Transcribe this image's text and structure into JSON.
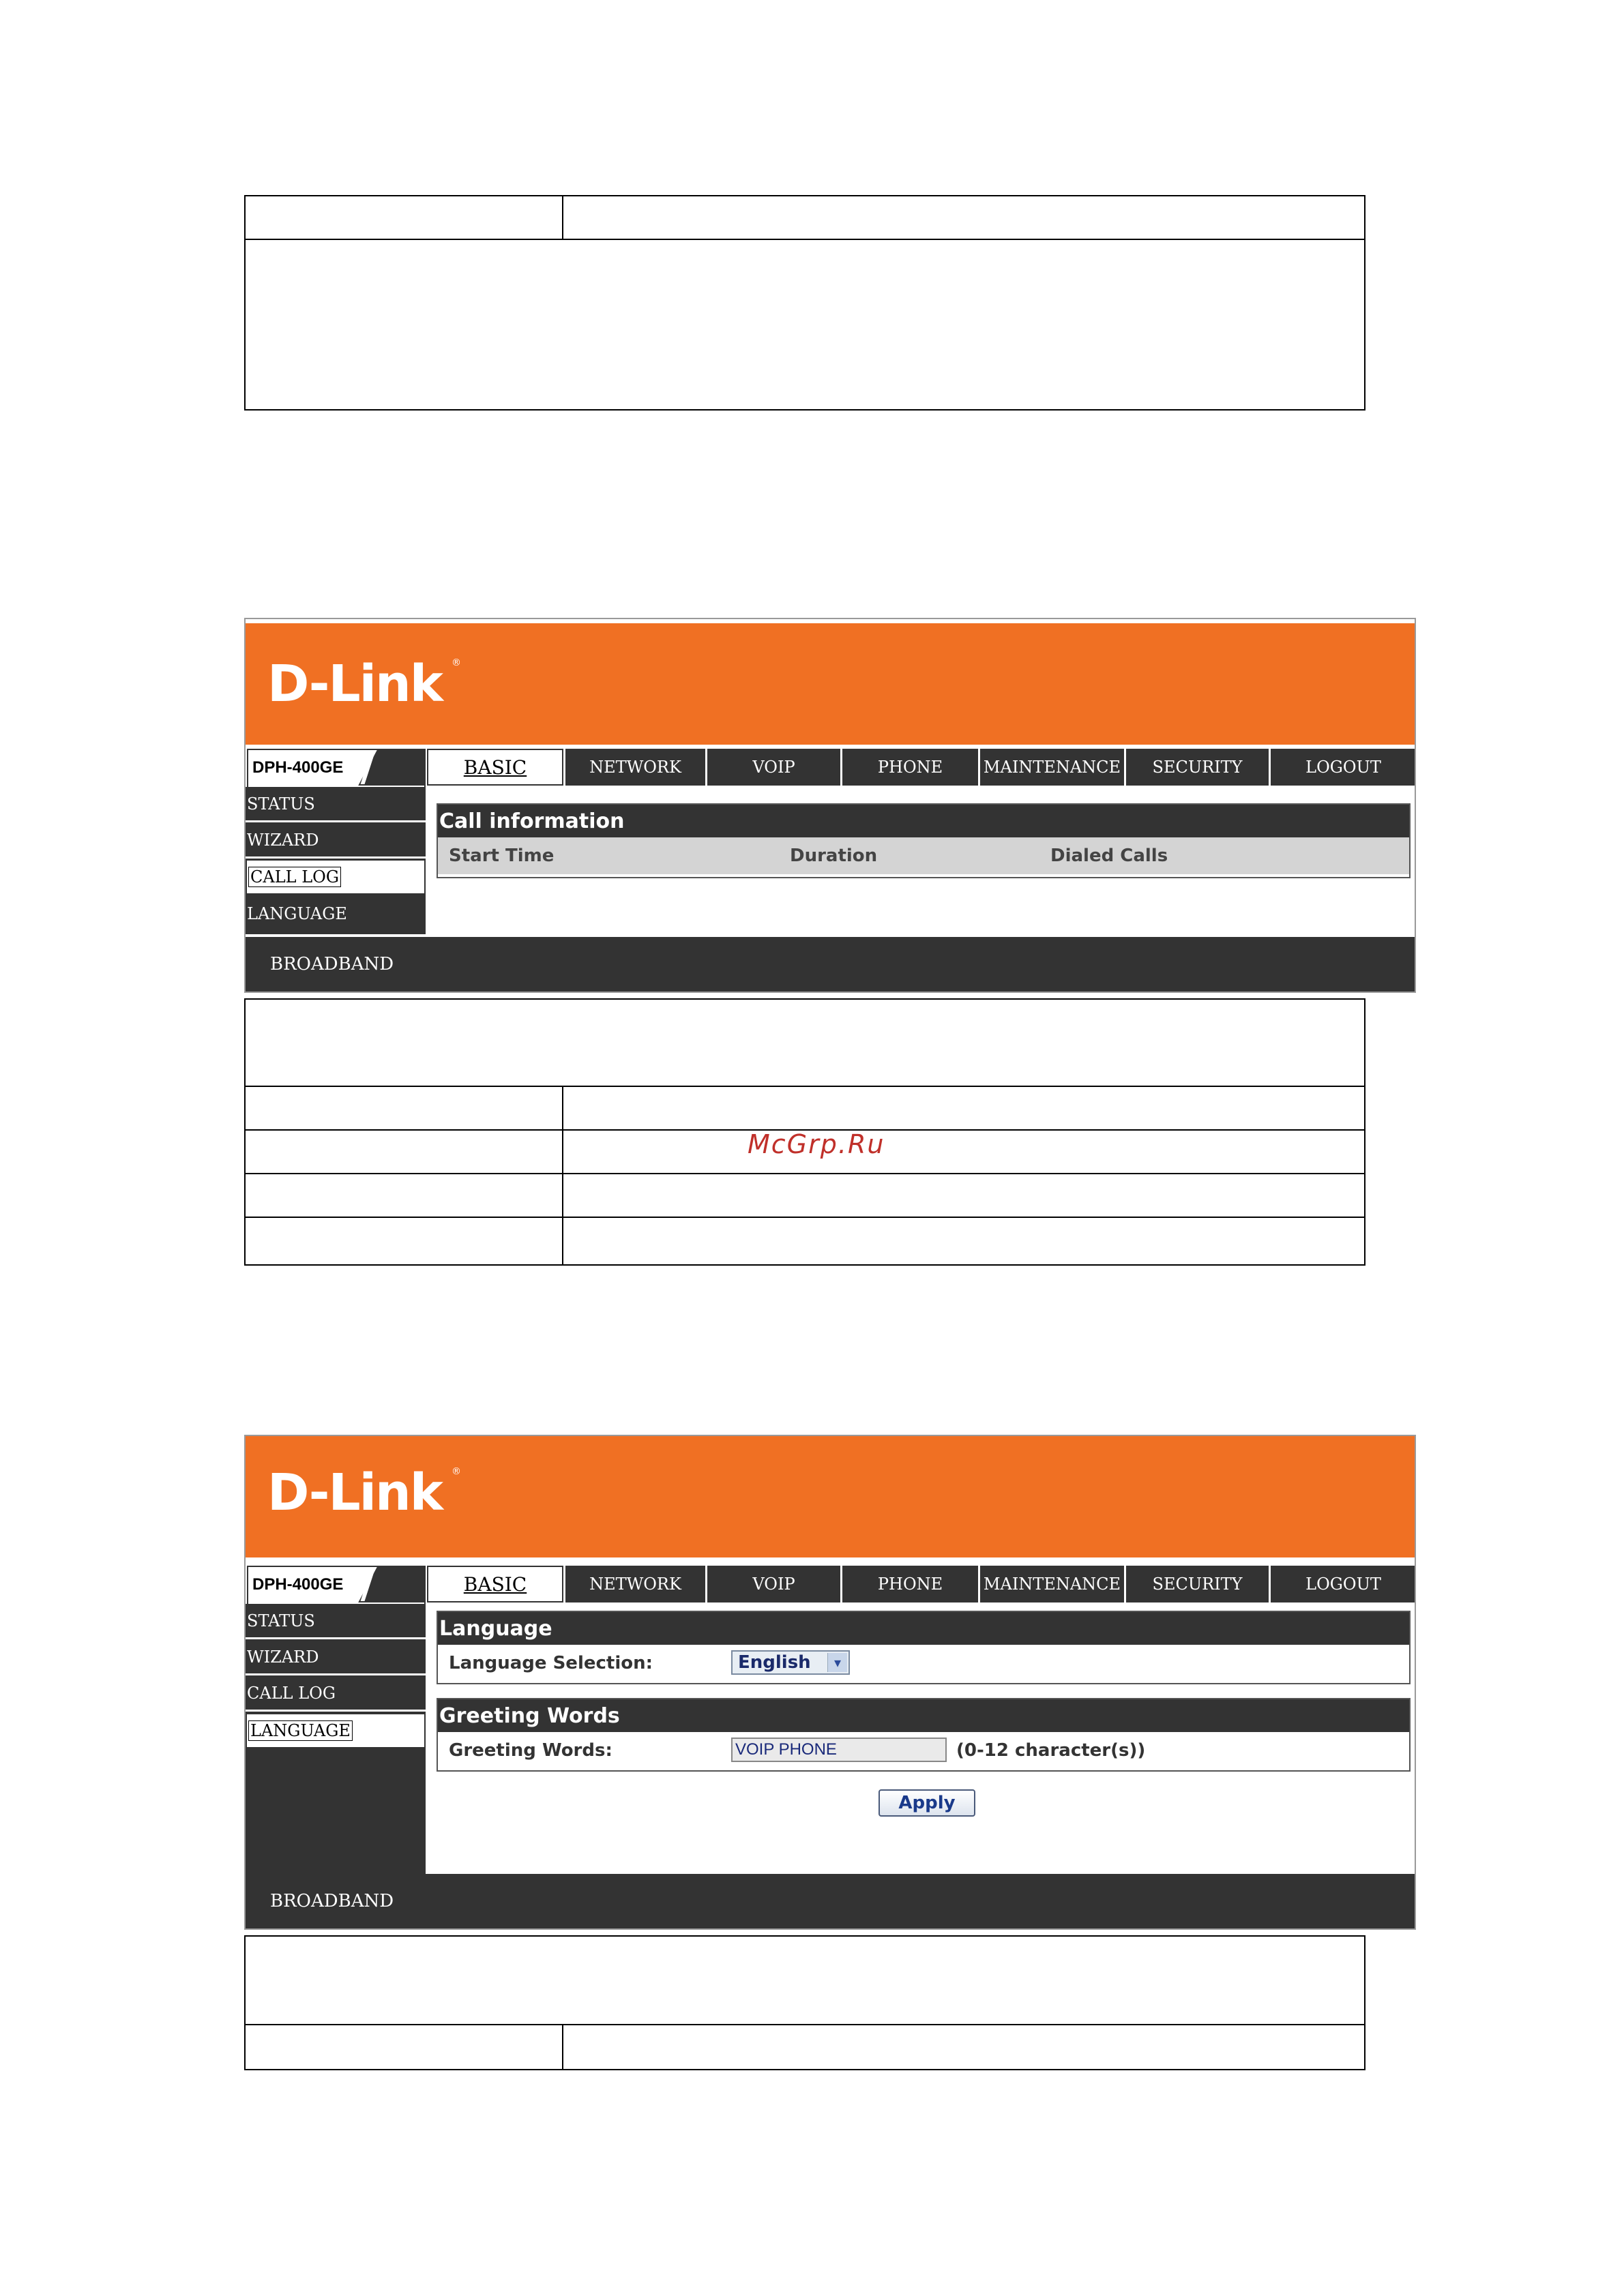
{
  "watermark": "McGrp.Ru",
  "brand": {
    "name": "D-Link",
    "registered_mark": "®",
    "model": "DPH-400GE",
    "accent_color": "#f07023",
    "bar_color": "#333333"
  },
  "nav_tabs": [
    "BASIC",
    "NETWORK",
    "VOIP",
    "PHONE",
    "MAINTENANCE",
    "SECURITY",
    "LOGOUT"
  ],
  "sidebar_items": [
    "STATUS",
    "WIZARD",
    "CALL LOG",
    "LANGUAGE"
  ],
  "footer_label": "BROADBAND",
  "panel1": {
    "active_tab": "BASIC",
    "active_sidebar": "CALL LOG",
    "section_title": "Call information",
    "columns": [
      "Start Time",
      "Duration",
      "Dialed Calls"
    ]
  },
  "panel2": {
    "active_tab": "BASIC",
    "active_sidebar": "LANGUAGE",
    "language_section_title": "Language",
    "language_label": "Language Selection:",
    "language_value": "English",
    "greeting_section_title": "Greeting Words",
    "greeting_label": "Greeting Words:",
    "greeting_value": "VOIP PHONE",
    "greeting_hint": "(0-12 character(s))",
    "apply_label": "Apply"
  },
  "icons": {
    "dropdown": "chevron-down-icon"
  }
}
